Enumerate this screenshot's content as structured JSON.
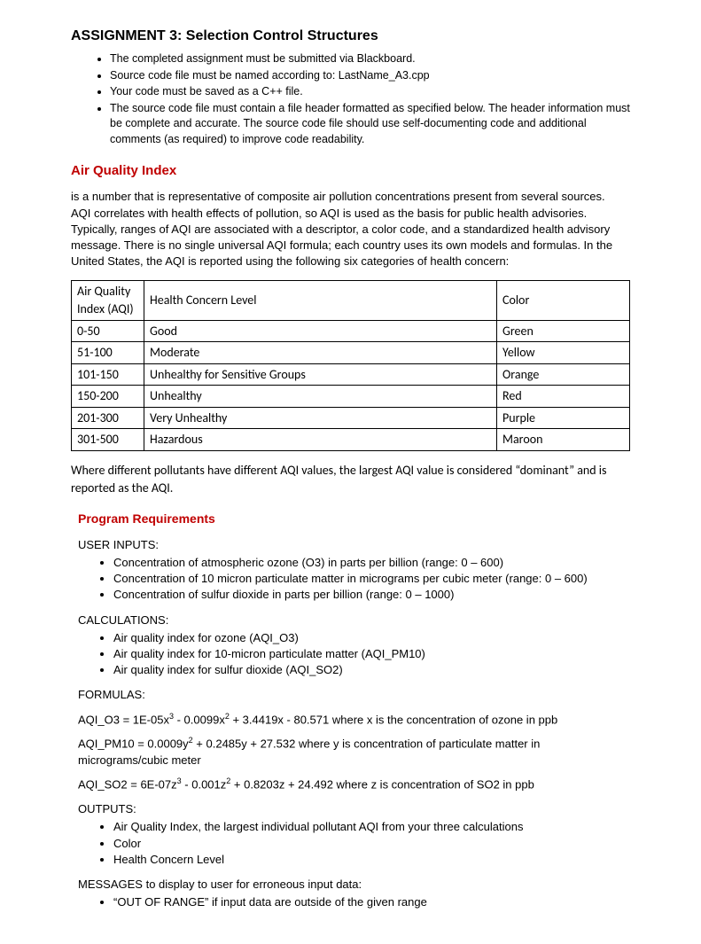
{
  "title": "ASSIGNMENT 3: Selection Control Structures",
  "bullets": [
    "The completed assignment must be submitted via Blackboard.",
    "Source code file must be named according to: LastName_A3.cpp",
    "Your code must be saved as a C++ file.",
    "The source code file must contain a file header formatted as specified below. The header information must be complete and accurate. The source code file should use self-documenting code and additional comments (as required) to improve code readability."
  ],
  "heading_aqi": "Air Quality Index",
  "para_aqi": "is a number that is representative of composite air pollution concentrations present from several sources.  AQI correlates with health effects of pollution, so AQI is used as the basis for public health advisories.  Typically, ranges of AQI are associated with a descriptor, a color code, and a standardized health advisory message.  There is no single universal AQI formula; each country uses its own models and formulas.  In the United States, the AQI is reported using the following six categories of health concern:",
  "table": {
    "headers": [
      "Air Quality Index (AQI)",
      "Health Concern Level",
      "Color"
    ],
    "rows": [
      [
        "0-50",
        "Good",
        "Green"
      ],
      [
        "51-100",
        "Moderate",
        "Yellow"
      ],
      [
        "101-150",
        "Unhealthy for Sensitive Groups",
        "Orange"
      ],
      [
        "150-200",
        "Unhealthy",
        "Red"
      ],
      [
        "201-300",
        "Very Unhealthy",
        "Purple"
      ],
      [
        "301-500",
        "Hazardous",
        "Maroon"
      ]
    ]
  },
  "note": "Where different pollutants have different AQI values, the largest AQI value is considered “dominant” and is reported as the AQI.",
  "heading_prog": "Program Requirements",
  "user_inputs_label": "USER INPUTS:",
  "user_inputs": [
    "Concentration of atmospheric ozone (O3) in parts per billion (range: 0 – 600)",
    "Concentration of 10 micron particulate matter in micrograms per cubic meter (range: 0 – 600)",
    "Concentration of sulfur dioxide in parts per billion  (range: 0 – 1000)"
  ],
  "calculations_label": "CALCULATIONS:",
  "calculations": [
    "Air quality index for ozone (AQI_O3)",
    "Air quality index for 10-micron particulate matter (AQI_PM10)",
    "Air quality index for sulfur dioxide (AQI_SO2)"
  ],
  "formulas_label": "FORMULAS:",
  "formula1_a": "AQI_O3 = 1E-05x",
  "formula1_b": " - 0.0099x",
  "formula1_c": " + 3.4419x - 80.571 where x is the concentration of ozone in ppb",
  "formula2_a": "AQI_PM10 = 0.0009y",
  "formula2_b": " + 0.2485y + 27.532 where y is concentration of particulate matter in micrograms/cubic meter",
  "formula3_a": "AQI_SO2 = 6E-07z",
  "formula3_b": " - 0.001z",
  "formula3_c": " + 0.8203z + 24.492 where z is concentration of SO2 in ppb",
  "sup3": "3",
  "sup2": "2",
  "outputs_label": "OUTPUTS:",
  "outputs": [
    "Air Quality Index, the largest individual pollutant AQI from your three calculations",
    "Color",
    "Health Concern Level"
  ],
  "messages_label": "MESSAGES to display to user for erroneous input data:",
  "messages": [
    "“OUT OF RANGE” if input data are outside of the given range"
  ]
}
